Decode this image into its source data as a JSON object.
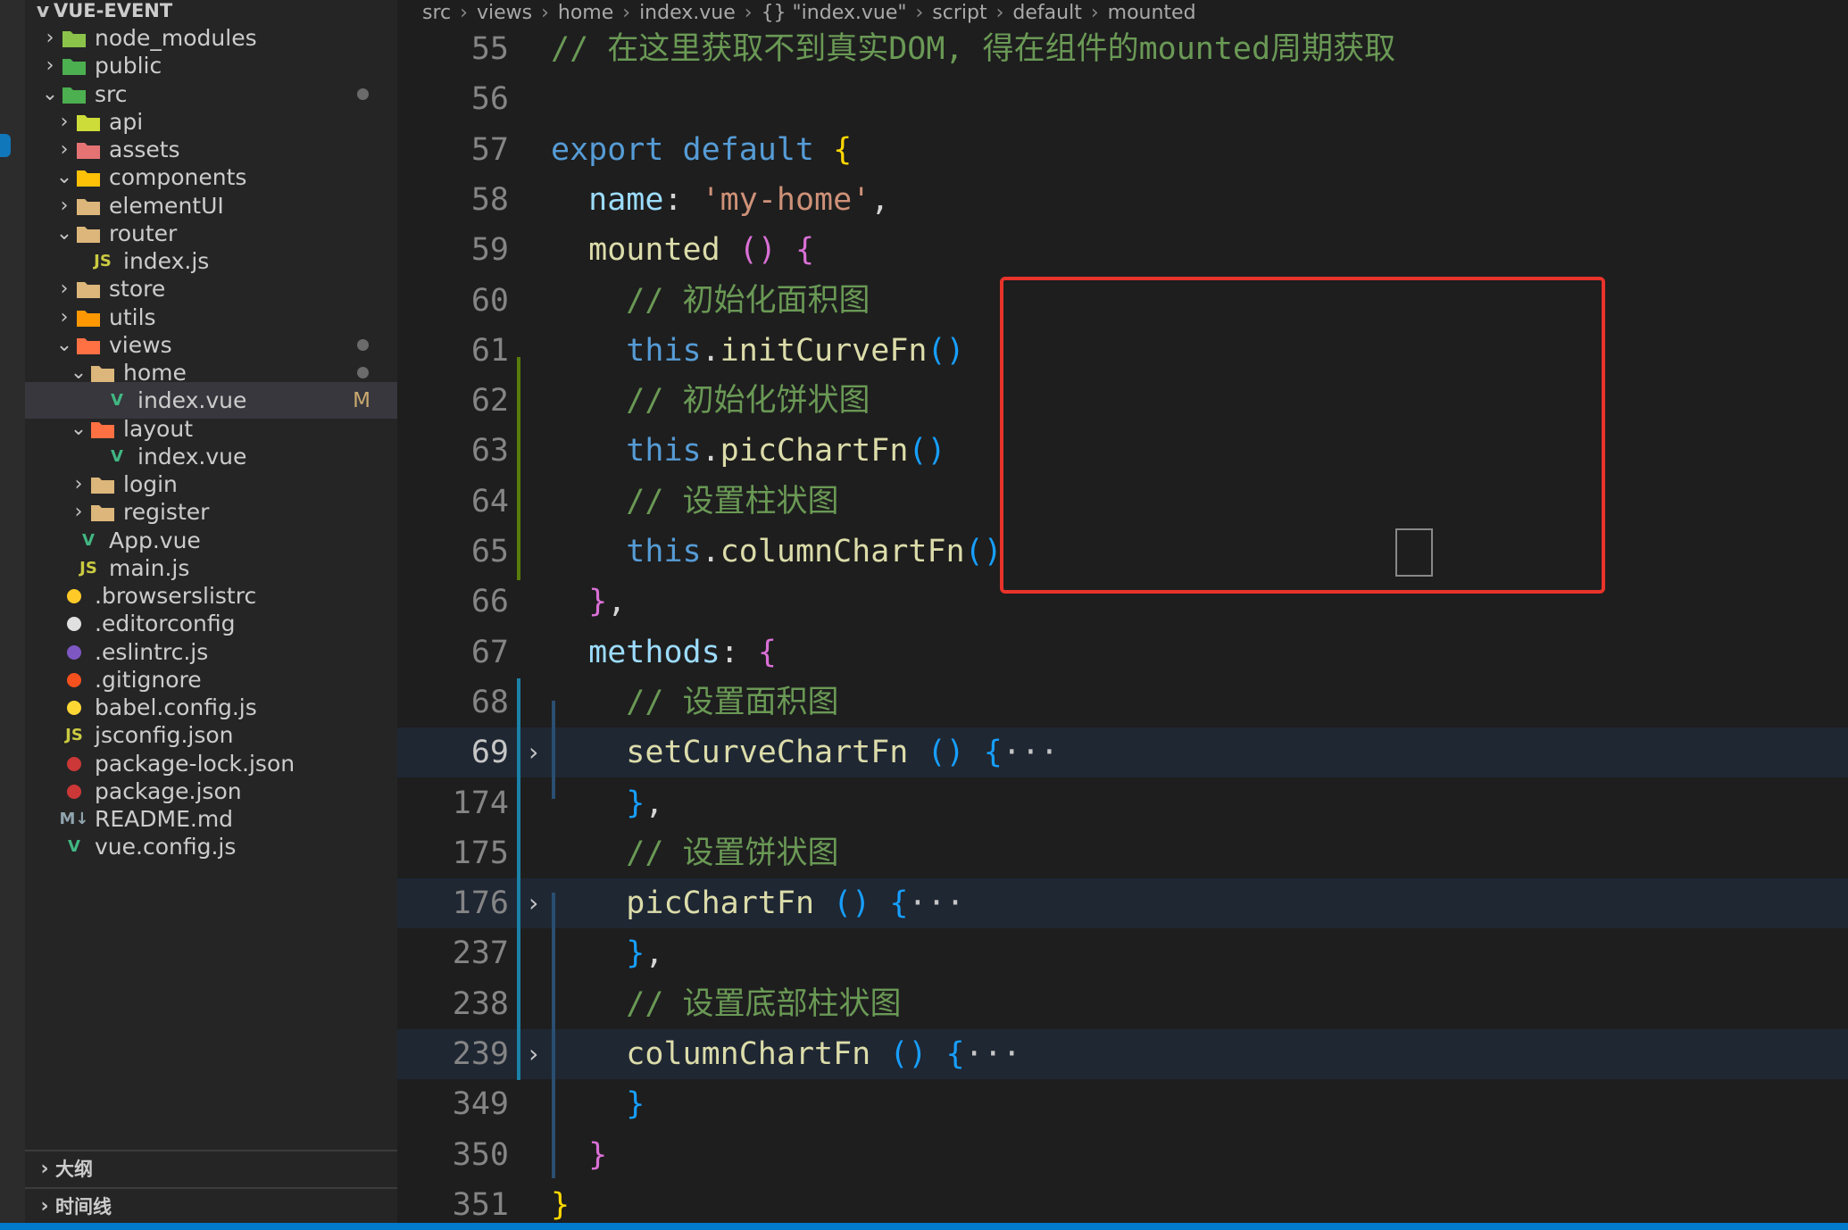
{
  "explorer": {
    "title": "VUE-EVENT",
    "items": [
      {
        "label": "node_modules",
        "chev": ">",
        "icon": "node-modules-folder-icon"
      },
      {
        "label": "public",
        "chev": ">",
        "icon": "public-folder-icon"
      },
      {
        "label": "src",
        "chev": "v",
        "icon": "src-folder-icon"
      },
      {
        "label": "api",
        "chev": ">",
        "icon": "api-folder-icon"
      },
      {
        "label": "assets",
        "chev": ">",
        "icon": "assets-folder-icon"
      },
      {
        "label": "components",
        "chev": "v",
        "icon": "components-folder-icon"
      },
      {
        "label": "elementUI",
        "chev": ">",
        "icon": "folder-icon"
      },
      {
        "label": "router",
        "chev": "v",
        "icon": "folder-icon"
      },
      {
        "label": "index.js",
        "chev": "",
        "icon": "js-file-icon",
        "glyph": "JS"
      },
      {
        "label": "store",
        "chev": ">",
        "icon": "folder-icon"
      },
      {
        "label": "utils",
        "chev": ">",
        "icon": "utils-folder-icon"
      },
      {
        "label": "views",
        "chev": "v",
        "icon": "views-folder-icon"
      },
      {
        "label": "home",
        "chev": "v",
        "icon": "folder-icon"
      },
      {
        "label": "index.vue",
        "chev": "",
        "icon": "vue-file-icon",
        "glyph": "V",
        "badge": "M"
      },
      {
        "label": "layout",
        "chev": "v",
        "icon": "layout-folder-icon"
      },
      {
        "label": "index.vue",
        "chev": "",
        "icon": "vue-file-icon",
        "glyph": "V"
      },
      {
        "label": "login",
        "chev": ">",
        "icon": "folder-icon"
      },
      {
        "label": "register",
        "chev": ">",
        "icon": "folder-icon"
      },
      {
        "label": "App.vue",
        "chev": "",
        "icon": "vue-file-icon",
        "glyph": "V"
      },
      {
        "label": "main.js",
        "chev": "",
        "icon": "js-file-icon",
        "glyph": "JS"
      },
      {
        "label": ".browserslistrc",
        "chev": "",
        "icon": "browserslist-file-icon"
      },
      {
        "label": ".editorconfig",
        "chev": "",
        "icon": "editorconfig-file-icon"
      },
      {
        "label": ".eslintrc.js",
        "chev": "",
        "icon": "eslint-file-icon"
      },
      {
        "label": ".gitignore",
        "chev": "",
        "icon": "git-file-icon"
      },
      {
        "label": "babel.config.js",
        "chev": "",
        "icon": "babel-file-icon"
      },
      {
        "label": "jsconfig.json",
        "chev": "",
        "icon": "js-file-icon",
        "glyph": "JS"
      },
      {
        "label": "package-lock.json",
        "chev": "",
        "icon": "npm-file-icon"
      },
      {
        "label": "package.json",
        "chev": "",
        "icon": "npm-file-icon"
      },
      {
        "label": "README.md",
        "chev": "",
        "icon": "markdown-file-icon",
        "glyph": "M↓"
      },
      {
        "label": "vue.config.js",
        "chev": "",
        "icon": "vue-config-file-icon",
        "glyph": "V"
      }
    ],
    "panels": {
      "outline": "大纲",
      "timeline": "时间线"
    }
  },
  "breadcrumb": [
    "src",
    "views",
    "home",
    "index.vue",
    "{} \"index.vue\"",
    "script",
    "default",
    "mounted"
  ],
  "editor": {
    "active_line": "69",
    "lines": [
      {
        "n": "55",
        "tokens": [
          [
            "c-comment",
            "// 在这里获取不到真实DOM, 得在组件的mounted周期获取"
          ]
        ]
      },
      {
        "n": "56",
        "tokens": []
      },
      {
        "n": "57",
        "tokens": [
          [
            "c-key",
            "export default "
          ],
          [
            "c-br1",
            "{"
          ]
        ]
      },
      {
        "n": "58",
        "tokens": [
          [
            "c-plain",
            "  "
          ],
          [
            "c-prop",
            "name"
          ],
          [
            "c-plain",
            ": "
          ],
          [
            "c-str",
            "'my-home'"
          ],
          [
            "c-plain",
            ","
          ]
        ]
      },
      {
        "n": "59",
        "tokens": [
          [
            "c-plain",
            "  "
          ],
          [
            "c-fn",
            "mounted "
          ],
          [
            "c-br2",
            "()"
          ],
          [
            "c-plain",
            " "
          ],
          [
            "c-br2",
            "{"
          ]
        ]
      },
      {
        "n": "60",
        "tokens": [
          [
            "c-plain",
            "    "
          ],
          [
            "c-comment",
            "// 初始化面积图"
          ]
        ]
      },
      {
        "n": "61",
        "tokens": [
          [
            "c-plain",
            "    "
          ],
          [
            "c-this",
            "this"
          ],
          [
            "c-plain",
            "."
          ],
          [
            "c-fn",
            "initCurveFn"
          ],
          [
            "c-br3",
            "()"
          ]
        ]
      },
      {
        "n": "62",
        "tokens": [
          [
            "c-plain",
            "    "
          ],
          [
            "c-comment",
            "// 初始化饼状图"
          ]
        ]
      },
      {
        "n": "63",
        "tokens": [
          [
            "c-plain",
            "    "
          ],
          [
            "c-this",
            "this"
          ],
          [
            "c-plain",
            "."
          ],
          [
            "c-fn",
            "picChartFn"
          ],
          [
            "c-br3",
            "()"
          ]
        ]
      },
      {
        "n": "64",
        "tokens": [
          [
            "c-plain",
            "    "
          ],
          [
            "c-comment",
            "// 设置柱状图"
          ]
        ]
      },
      {
        "n": "65",
        "tokens": [
          [
            "c-plain",
            "    "
          ],
          [
            "c-this",
            "this"
          ],
          [
            "c-plain",
            "."
          ],
          [
            "c-fn",
            "columnChartFn"
          ],
          [
            "c-br3",
            "()"
          ]
        ]
      },
      {
        "n": "66",
        "tokens": [
          [
            "c-plain",
            "  "
          ],
          [
            "c-br2",
            "}"
          ],
          [
            "c-plain",
            ","
          ]
        ]
      },
      {
        "n": "67",
        "tokens": [
          [
            "c-plain",
            "  "
          ],
          [
            "c-prop",
            "methods"
          ],
          [
            "c-plain",
            ": "
          ],
          [
            "c-br2",
            "{"
          ]
        ]
      },
      {
        "n": "68",
        "tokens": [
          [
            "c-plain",
            "    "
          ],
          [
            "c-comment",
            "// 设置面积图"
          ]
        ]
      },
      {
        "n": "69",
        "fold": true,
        "tokens": [
          [
            "c-plain",
            "    "
          ],
          [
            "c-fn",
            "setCurveChartFn "
          ],
          [
            "c-br3",
            "()"
          ],
          [
            "c-plain",
            " "
          ],
          [
            "c-br3",
            "{"
          ],
          [
            "c-ell",
            "···"
          ]
        ]
      },
      {
        "n": "174",
        "tokens": [
          [
            "c-plain",
            "    "
          ],
          [
            "c-br3",
            "}"
          ],
          [
            "c-plain",
            ","
          ]
        ]
      },
      {
        "n": "175",
        "tokens": [
          [
            "c-plain",
            "    "
          ],
          [
            "c-comment",
            "// 设置饼状图"
          ]
        ]
      },
      {
        "n": "176",
        "fold": true,
        "tokens": [
          [
            "c-plain",
            "    "
          ],
          [
            "c-fn",
            "picChartFn "
          ],
          [
            "c-br3",
            "()"
          ],
          [
            "c-plain",
            " "
          ],
          [
            "c-br3",
            "{"
          ],
          [
            "c-ell",
            "···"
          ]
        ]
      },
      {
        "n": "237",
        "tokens": [
          [
            "c-plain",
            "    "
          ],
          [
            "c-br3",
            "}"
          ],
          [
            "c-plain",
            ","
          ]
        ]
      },
      {
        "n": "238",
        "tokens": [
          [
            "c-plain",
            "    "
          ],
          [
            "c-comment",
            "// 设置底部柱状图"
          ]
        ]
      },
      {
        "n": "239",
        "fold": true,
        "tokens": [
          [
            "c-plain",
            "    "
          ],
          [
            "c-fn",
            "columnChartFn "
          ],
          [
            "c-br3",
            "()"
          ],
          [
            "c-plain",
            " "
          ],
          [
            "c-br3",
            "{"
          ],
          [
            "c-ell",
            "···"
          ]
        ]
      },
      {
        "n": "349",
        "tokens": [
          [
            "c-plain",
            "    "
          ],
          [
            "c-br3",
            "}"
          ]
        ]
      },
      {
        "n": "350",
        "tokens": [
          [
            "c-plain",
            "  "
          ],
          [
            "c-br2",
            "}"
          ]
        ]
      },
      {
        "n": "351",
        "tokens": [
          [
            "c-br1",
            "}"
          ]
        ]
      }
    ]
  },
  "colors": {
    "accent": "#007acc",
    "highlight_box": "#e8332a",
    "modified_badge": "#c9a96e"
  }
}
